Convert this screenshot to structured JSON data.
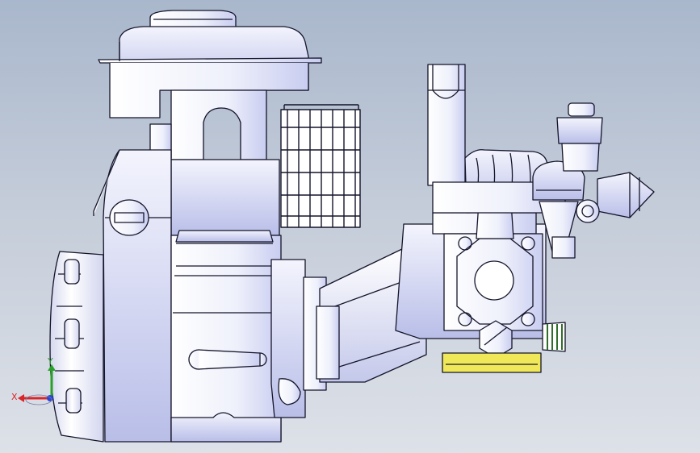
{
  "viewport": {
    "background_top": "#a9b7cc",
    "background_bottom": "#dde1e8"
  },
  "model": {
    "body_color": "#eef0fb",
    "shade_color": "#c9cdf0",
    "edge_color": "#14142a",
    "accent_color": "#f0e858",
    "thread_color": "#2f6d2a"
  },
  "triad": {
    "x_label": "X",
    "y_label": "Y",
    "x_color": "#d8262a",
    "y_color": "#2aa02a",
    "z_color": "#2a46d8"
  }
}
